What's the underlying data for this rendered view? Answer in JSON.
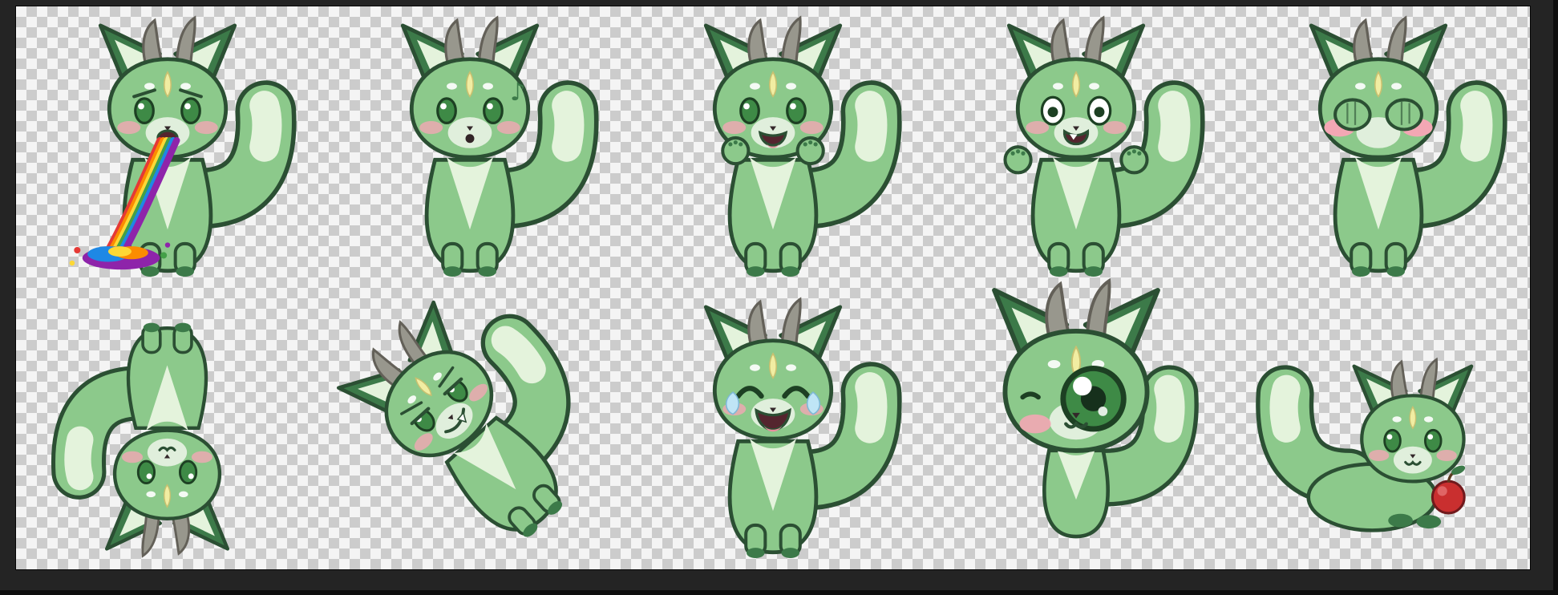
{
  "scene": {
    "description": "Sticker sheet of ten chibi green horned fox-dragon characters rendered on a transparent checkerboard canvas inside a dark editor frame"
  },
  "canvas": {
    "checker_light": "#f4f4f4",
    "checker_dark": "#cccccc",
    "frame_color": "#242424"
  },
  "palette": {
    "body_green": "#8cc98b",
    "dark_green": "#3c7a49",
    "cream": "#e4f3dc",
    "outline": "#2b4f33",
    "horn": "#98978d",
    "horn_dark": "#636058",
    "spot_yellow": "#f1eda2",
    "blush": "#f3a7b4",
    "eye_green": "#3e8a46",
    "eye_dark": "#1d4023",
    "mouth": "#54252e",
    "tongue": "#e88e9d",
    "tear": "#bfe5f6",
    "apple": "#c92f2f",
    "rainbow": [
      "#e53935",
      "#fb8c00",
      "#fdd835",
      "#43a047",
      "#1e88e5",
      "#8e24aa"
    ],
    "music_note_glyph": "♪"
  },
  "stickers": [
    {
      "name": "rainbow-vomit-fox",
      "emotion": "queasy",
      "eyes": "sad",
      "mouth": "open-small",
      "pose": "front",
      "extras": [
        "rainbow"
      ],
      "scale": 1
    },
    {
      "name": "whistling-fox",
      "emotion": "innocent-whistle",
      "eyes": "normal",
      "mouth": "whistle",
      "pose": "front",
      "extras": [
        "music-note"
      ],
      "scale": 1
    },
    {
      "name": "excited-fox",
      "emotion": "excited",
      "eyes": "normal",
      "mouth": "open-happy",
      "pose": "front",
      "extras": [
        "paws-up"
      ],
      "scale": 1
    },
    {
      "name": "shocked-fox",
      "emotion": "shocked",
      "eyes": "wide",
      "mouth": "shock",
      "pose": "front",
      "extras": [
        "paws-out"
      ],
      "scale": 1
    },
    {
      "name": "shy-fox",
      "emotion": "embarrassed-crying",
      "eyes": "covered",
      "mouth": "none",
      "pose": "front",
      "extras": [
        "paws-cover",
        "heavy-blush"
      ],
      "scale": 1
    },
    {
      "name": "handstand-fox",
      "emotion": "playful-upside-down",
      "eyes": "normal",
      "mouth": "cat",
      "pose": "upside-down",
      "extras": [],
      "scale": 0.9
    },
    {
      "name": "smug-fox",
      "emotion": "smug-kicking",
      "eyes": "halflid",
      "mouth": "fang-grin",
      "pose": "tilted",
      "extras": [],
      "scale": 0.95
    },
    {
      "name": "laughing-fox",
      "emotion": "laughing-with-tears",
      "eyes": "happy",
      "mouth": "laugh",
      "pose": "front",
      "extras": [
        "tears"
      ],
      "scale": 1
    },
    {
      "name": "curious-fox",
      "emotion": "curious-big-eye",
      "eyes": "big",
      "mouth": "cat",
      "pose": "bighead",
      "extras": [],
      "scale": 0.95
    },
    {
      "name": "apple-fox",
      "emotion": "content-with-apple",
      "eyes": "normal",
      "mouth": "cat",
      "pose": "lying",
      "extras": [
        "apple"
      ],
      "scale": 0.95
    }
  ]
}
